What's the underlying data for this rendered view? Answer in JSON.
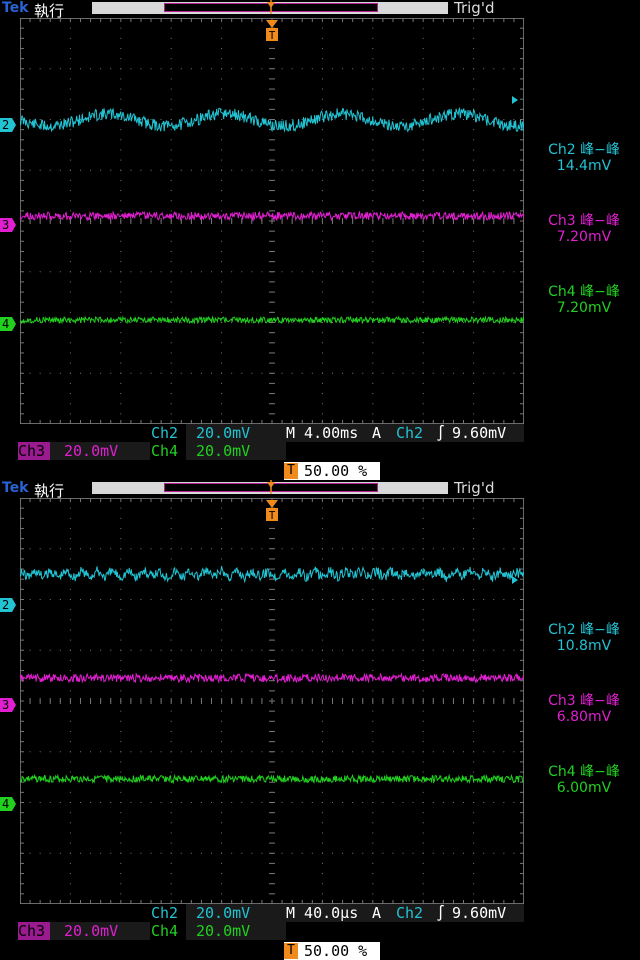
{
  "screens": [
    {
      "brand": "Tek",
      "acq_state": "執行",
      "trigger_status": "Trig'd",
      "channels": [
        {
          "marker": "2",
          "color": "#22c3d3"
        },
        {
          "marker": "3",
          "color": "#e020d0"
        },
        {
          "marker": "4",
          "color": "#22d020"
        }
      ],
      "measurements": [
        {
          "label": "Ch2 峰−峰",
          "value": "14.4mV",
          "color": "#22c3d3"
        },
        {
          "label": "Ch3 峰−峰",
          "value": "7.20mV",
          "color": "#e020d0"
        },
        {
          "label": "Ch4 峰−峰",
          "value": "7.20mV",
          "color": "#22d020"
        }
      ],
      "status": {
        "ch2_name": "Ch2",
        "ch2_scale": "20.0mV",
        "timebase": "M 4.00ms",
        "trig_mode": "A",
        "trig_source": "Ch2",
        "trig_slope": "∫",
        "trig_level": "9.60mV",
        "ch3_name": "Ch3",
        "ch3_scale": "20.0mV",
        "ch4_name": "Ch4",
        "ch4_scale": "20.0mV",
        "trigger_position": "50.00 %",
        "t_marker": "T"
      }
    },
    {
      "brand": "Tek",
      "acq_state": "執行",
      "trigger_status": "Trig'd",
      "channels": [
        {
          "marker": "2",
          "color": "#22c3d3"
        },
        {
          "marker": "3",
          "color": "#e020d0"
        },
        {
          "marker": "4",
          "color": "#22d020"
        }
      ],
      "measurements": [
        {
          "label": "Ch2 峰−峰",
          "value": "10.8mV",
          "color": "#22c3d3"
        },
        {
          "label": "Ch3 峰−峰",
          "value": "6.80mV",
          "color": "#e020d0"
        },
        {
          "label": "Ch4 峰−峰",
          "value": "6.00mV",
          "color": "#22d020"
        }
      ],
      "status": {
        "ch2_name": "Ch2",
        "ch2_scale": "20.0mV",
        "timebase": "M 40.0µs",
        "trig_mode": "A",
        "trig_source": "Ch2",
        "trig_slope": "∫",
        "trig_level": "9.60mV",
        "ch3_name": "Ch3",
        "ch3_scale": "20.0mV",
        "ch4_name": "Ch4",
        "ch4_scale": "20.0mV",
        "trigger_position": "50.00 %",
        "t_marker": "T"
      }
    }
  ]
}
